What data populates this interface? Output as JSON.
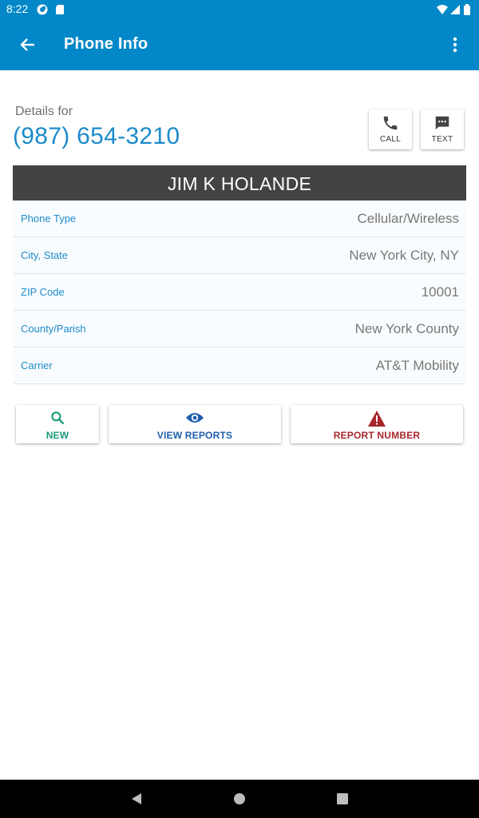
{
  "status_bar": {
    "time": "8:22",
    "icons": [
      "assistant-icon",
      "sd-card-icon",
      "wifi-icon",
      "signal-icon",
      "battery-icon"
    ]
  },
  "app_bar": {
    "title": "Phone Info",
    "back_icon": "arrow-back-icon",
    "menu_icon": "more-vert-icon",
    "background": "#0288c8"
  },
  "details": {
    "label": "Details for",
    "phone_number": "(987) 654-3210",
    "call_label": "CALL",
    "text_label": "TEXT"
  },
  "owner": {
    "name": "JIM K HOLANDE"
  },
  "info_rows": [
    {
      "key": "Phone Type",
      "value": "Cellular/Wireless"
    },
    {
      "key": "City, State",
      "value": "New York City, NY"
    },
    {
      "key": "ZIP Code",
      "value": "10001"
    },
    {
      "key": "County/Parish",
      "value": "New York County"
    },
    {
      "key": "Carrier",
      "value": "AT&T Mobility"
    }
  ],
  "actions": {
    "new_label": "NEW",
    "view_reports_label": "VIEW REPORTS",
    "report_number_label": "REPORT NUMBER",
    "colors": {
      "new": "#1a9c7c",
      "view_reports": "#1f5fae",
      "report_number": "#a8272d"
    }
  },
  "nav": {
    "icons": [
      "back-triangle-icon",
      "home-circle-icon",
      "recents-square-icon"
    ]
  }
}
